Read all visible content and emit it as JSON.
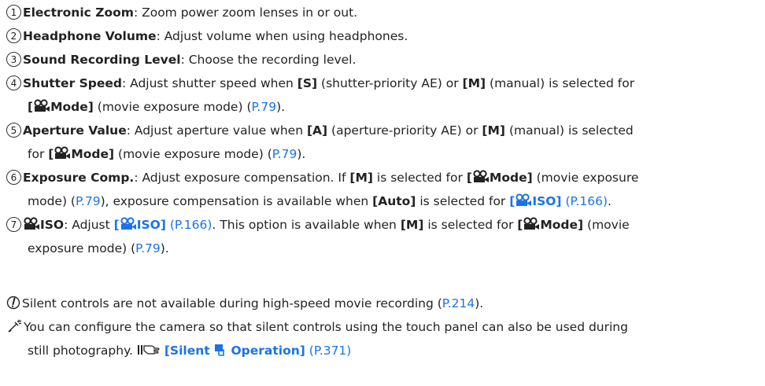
{
  "items": [
    {
      "num": "1",
      "title": "Electronic Zoom",
      "desc": ": Zoom power zoom lenses in or out."
    },
    {
      "num": "2",
      "title": "Headphone Volume",
      "desc": ": Adjust volume when using headphones."
    },
    {
      "num": "3",
      "title": "Sound Recording Level",
      "desc": ": Choose the recording level."
    },
    {
      "num": "4",
      "title": "Shutter Speed",
      "t1": ": Adjust shutter speed when ",
      "b1": "[S]",
      "t2": " (shutter-priority AE) or ",
      "b2": "[M]",
      "t3": " (manual) is selected for",
      "b3_open": "[",
      "b3_close": "Mode]",
      "t4": " (movie exposure mode) (",
      "link": "P.79",
      "t5": ")."
    },
    {
      "num": "5",
      "title": "Aperture Value",
      "t1": ": Adjust aperture value when ",
      "b1": "[A]",
      "t2": " (aperture-priority AE) or ",
      "b2": "[M]",
      "t3": " (manual) is selected",
      "t3b": "for ",
      "b3_open": "[",
      "b3_close": "Mode]",
      "t4": " (movie exposure mode) (",
      "link": "P.79",
      "t5": ")."
    },
    {
      "num": "6",
      "title": "Exposure Comp.",
      "t1": ": Adjust exposure compensation. If ",
      "b1": "[M]",
      "t2": " is selected for ",
      "b3_open": "[",
      "b3_close": "Mode]",
      "t3": " (movie exposure",
      "t4": "mode) (",
      "link": "P.79",
      "t5": "), exposure compensation is available when ",
      "b2": "[Auto]",
      "t6": " is selected for ",
      "l_open": "[",
      "l_close": "ISO]",
      "link2": "(P.166)",
      "t7": "."
    },
    {
      "num": "7",
      "title": "ISO",
      "t1": ": Adjust ",
      "l_open": "[",
      "l_close": "ISO]",
      "link2": "(P.166)",
      "t2": ". This option is available when ",
      "b1": "[M]",
      "t3": " is selected for ",
      "b3_open": "[",
      "b3_close": "Mode]",
      "t4": " (movie",
      "t5": "exposure mode) (",
      "link": "P.79",
      "t6": ")."
    }
  ],
  "notes": [
    {
      "icon": "caution-icon",
      "t1": "Silent controls are not available during high-speed movie recording (",
      "link": "P.214",
      "t2": ")."
    },
    {
      "icon": "tip-icon",
      "t1": "You can configure the camera so that silent controls using the touch panel can also be used during",
      "t2": "still photography. ",
      "l_open": "[Silent ",
      "l_close": " Operation]",
      "link": "(P.371)"
    }
  ],
  "colors": {
    "link": "#1a73e8",
    "text": "#222222"
  }
}
